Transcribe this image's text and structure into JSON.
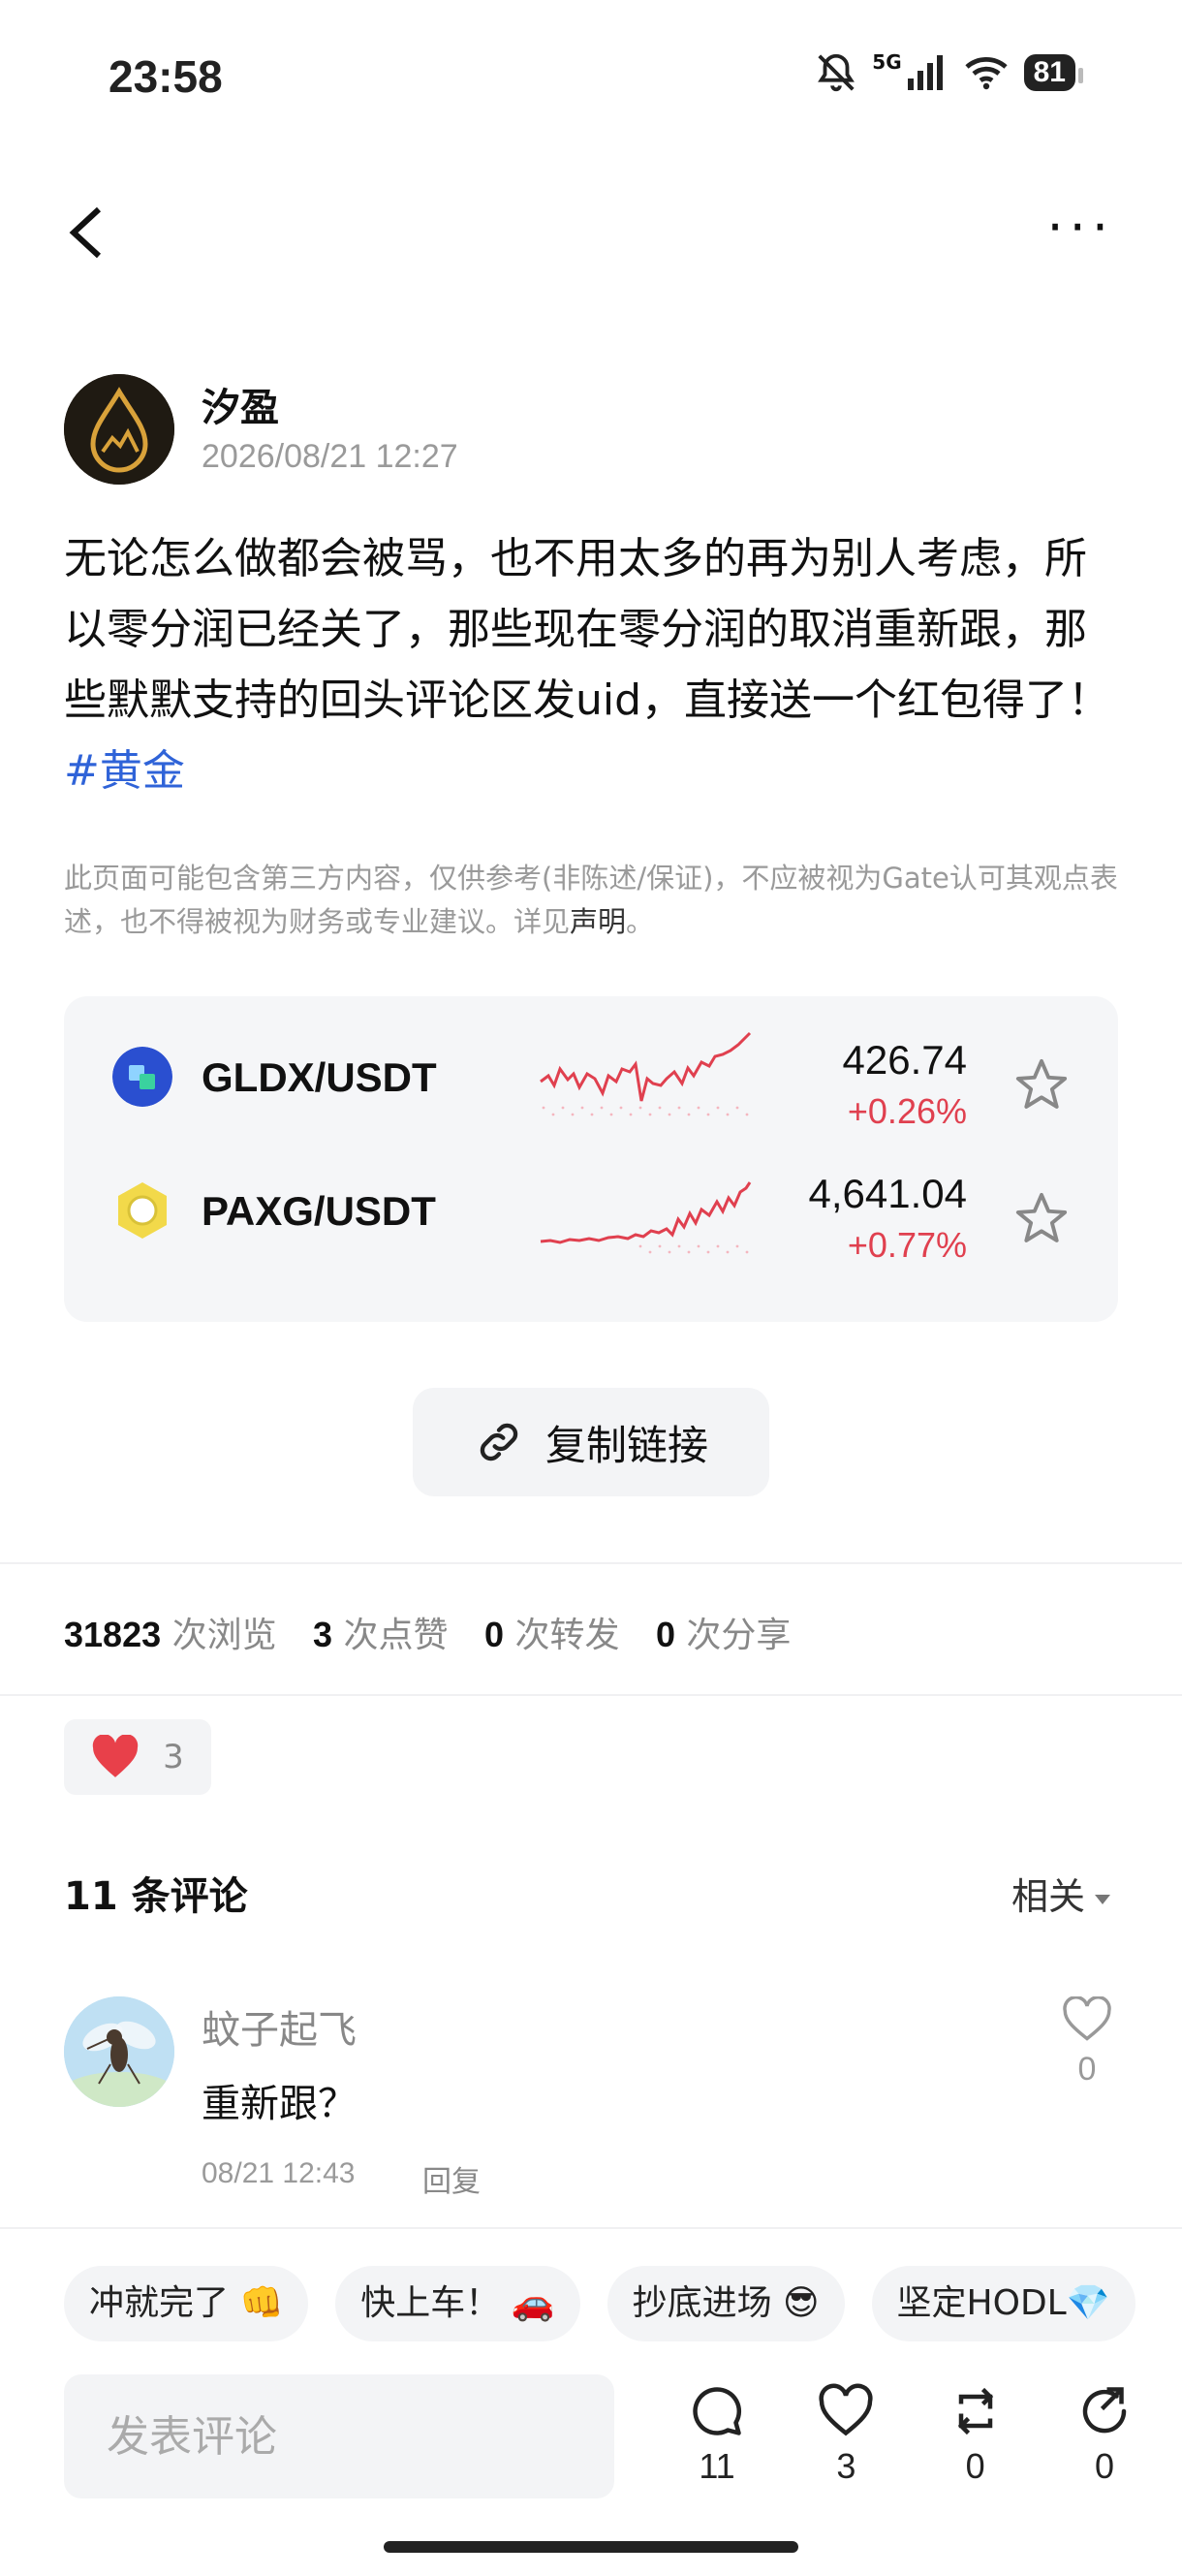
{
  "status_bar": {
    "time": "23:58",
    "network": "5G",
    "battery": "81"
  },
  "post": {
    "author": "汐盈",
    "date": "2026/08/21 12:27",
    "content": "无论怎么做都会被骂，也不用太多的再为别人考虑，所以零分润已经关了，那些现在零分润的取消重新跟，那些默默支持的回头评论区发uid，直接送一个红包得了！",
    "hashtag": "#黄金",
    "disclaimer": "此页面可能包含第三方内容，仅供参考(非陈述/保证)，不应被视为Gate认可其观点表述，也不得被视为财务或专业建议。详见",
    "disclaimer_link": "声明",
    "disclaimer_end": "。"
  },
  "markets": [
    {
      "pair": "GLDX/USDT",
      "price": "426.74",
      "change": "+0.26%",
      "icon": "gldx-coin-icon"
    },
    {
      "pair": "PAXG/USDT",
      "price": "4,641.04",
      "change": "+0.77%",
      "icon": "paxg-coin-icon"
    }
  ],
  "copy_link_label": "复制链接",
  "stats": {
    "views": "31823",
    "views_label": "次浏览",
    "likes": "3",
    "likes_label": "次点赞",
    "reposts": "0",
    "reposts_label": "次转发",
    "shares": "0",
    "shares_label": "次分享"
  },
  "reaction": {
    "emoji": "❤️",
    "count": "3"
  },
  "comments_header": {
    "title": "11 条评论",
    "sort": "相关"
  },
  "comments": [
    {
      "user": "蚊子起飞",
      "text": "重新跟？",
      "time": "08/21 12:43",
      "reply": "回复",
      "likes": "0"
    }
  ],
  "quick_replies": [
    "冲就完了 👊",
    "快上车！ 🚗",
    "抄底进场 😎",
    "坚定HODL💎"
  ],
  "comment_input": {
    "placeholder": "发表评论"
  },
  "bottom_actions": {
    "comments": "11",
    "likes": "3",
    "reposts": "0",
    "shares": "0"
  },
  "colors": {
    "up": "#e0404f",
    "link": "#2f63d8",
    "gold": "#d9a23a"
  }
}
